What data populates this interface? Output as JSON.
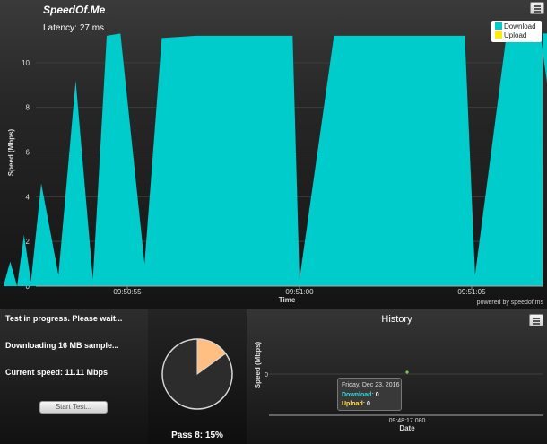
{
  "brand": "SpeedOf.Me",
  "latency": {
    "label": "Latency:",
    "value": "27 ms"
  },
  "powered_by": "powered by speedof.ms",
  "legend": {
    "download": "Download",
    "upload": "Upload"
  },
  "colors": {
    "download": "#00cccc",
    "upload": "#ffee00",
    "pie_progress": "#ffbe82"
  },
  "icons": {
    "menu": "hamburger-menu-icon"
  },
  "chart_data": [
    {
      "type": "area",
      "title": "",
      "xlabel": "Time",
      "ylabel": "Speed (Mbps)",
      "ylim": [
        0,
        12
      ],
      "yticks": [
        0,
        2,
        4,
        6,
        8,
        10
      ],
      "x_ticks": [
        "09:50:55",
        "09:51:00",
        "09:51:05"
      ],
      "grid": true,
      "legend_placement": "top-right",
      "series": [
        {
          "name": "Download",
          "x_seconds_relative": [
            -3.6,
            -3.4,
            -3.2,
            -3.0,
            -2.8,
            -2.5,
            -2.0,
            -1.5,
            -1.0,
            -0.6,
            -0.2,
            0.5,
            1.0,
            2.0,
            3.0,
            4.0,
            4.8,
            5.0,
            6.0,
            7.0,
            8.0,
            9.0,
            9.8,
            10.1,
            11.0,
            12.0,
            13.0,
            14.0,
            14.8,
            15.0
          ],
          "values": [
            0.0,
            1.1,
            0.0,
            2.3,
            0.2,
            4.6,
            0.5,
            9.2,
            0.3,
            11.2,
            11.3,
            1.0,
            11.1,
            11.2,
            11.2,
            11.2,
            11.2,
            0.3,
            11.2,
            11.2,
            11.2,
            11.2,
            11.2,
            0.5,
            11.1,
            11.2,
            0.0,
            11.2,
            11.2,
            11.3
          ]
        },
        {
          "name": "Upload",
          "values": []
        }
      ]
    },
    {
      "type": "pie",
      "values": [
        15,
        85
      ]
    },
    {
      "type": "scatter",
      "title": "History",
      "xlabel": "Date",
      "ylabel": "Speed (Mbps)",
      "x_ticks": [
        "09:48:17.080"
      ],
      "y_ticks": [
        0
      ],
      "series": [
        {
          "name": "Download",
          "values": [
            0
          ]
        },
        {
          "name": "Upload",
          "values": [
            0
          ]
        }
      ]
    }
  ],
  "status": {
    "line1": "Test in progress. Please wait...",
    "line2": "Downloading 16 MB sample...",
    "line3": "Current speed: 11.11 Mbps"
  },
  "start_button": "Start Test...",
  "pass_label": "Pass 8: 15%",
  "history": {
    "title": "History",
    "tooltip": {
      "date": "Friday, Dec 23, 2016",
      "download_label": "Download:",
      "download_value": "0",
      "upload_label": "Upload:",
      "upload_value": "0"
    }
  }
}
